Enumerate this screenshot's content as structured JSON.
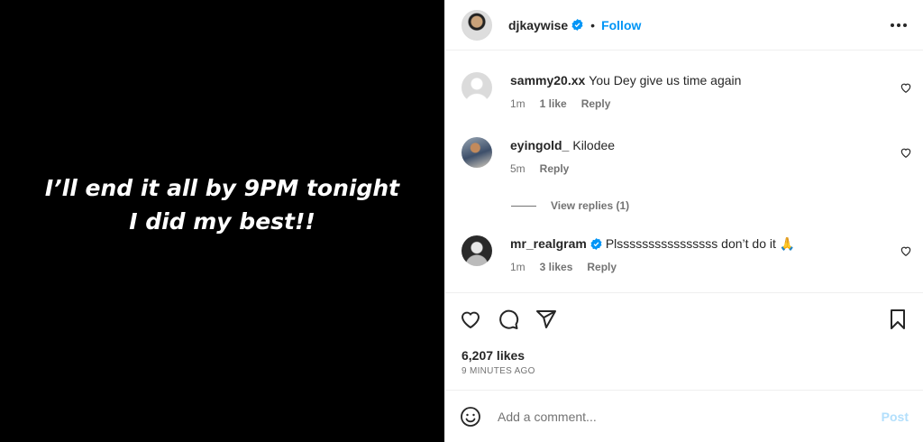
{
  "post": {
    "media_text_line1": "I’ll end it all by 9PM tonight",
    "media_text_line2": "I did my best!!"
  },
  "header": {
    "username": "djkaywise",
    "separator": "•",
    "follow_label": "Follow"
  },
  "comments": [
    {
      "username": "sammy20.xx",
      "text": "You Dey give us time again",
      "time": "1m",
      "likes": "1 like",
      "reply_label": "Reply"
    },
    {
      "username": "eyingold_",
      "text": "Kilodee",
      "time": "5m",
      "reply_label": "Reply"
    },
    {
      "username": "mr_realgram",
      "text": "Plssssssssssssssss don’t do it 🙏",
      "time": "1m",
      "likes": "3 likes",
      "reply_label": "Reply"
    }
  ],
  "view_replies_label": "View replies (1)",
  "likes_count": "6,207 likes",
  "time_ago": "9 MINUTES AGO",
  "add_comment": {
    "placeholder": "Add a comment...",
    "post_label": "Post"
  },
  "colors": {
    "accent": "#0095f6",
    "post_disabled": "#b2dffc",
    "media_bg": "#000000"
  },
  "icons": [
    "verified-badge-icon",
    "more-options-icon",
    "heart-icon",
    "comment-icon",
    "share-icon",
    "bookmark-icon",
    "emoji-icon"
  ]
}
